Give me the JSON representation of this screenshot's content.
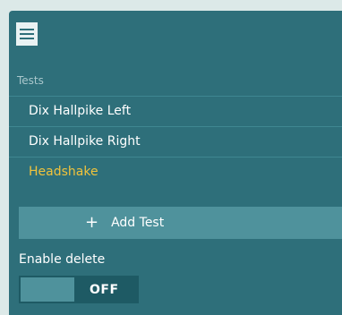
{
  "menu": {
    "icon": "hamburger-icon"
  },
  "tests": {
    "section_label": "Tests",
    "items": [
      {
        "label": "Dix Hallpike Left",
        "active": false
      },
      {
        "label": "Dix Hallpike Right",
        "active": false
      },
      {
        "label": "Headshake",
        "active": true
      }
    ]
  },
  "add_test": {
    "icon": "plus-icon",
    "symbol": "+",
    "label": "Add Test"
  },
  "enable_delete": {
    "label": "Enable delete",
    "state": "OFF"
  },
  "colors": {
    "panel": "#2e6f7a",
    "accent": "#f0c33c",
    "button": "#4f929c"
  }
}
